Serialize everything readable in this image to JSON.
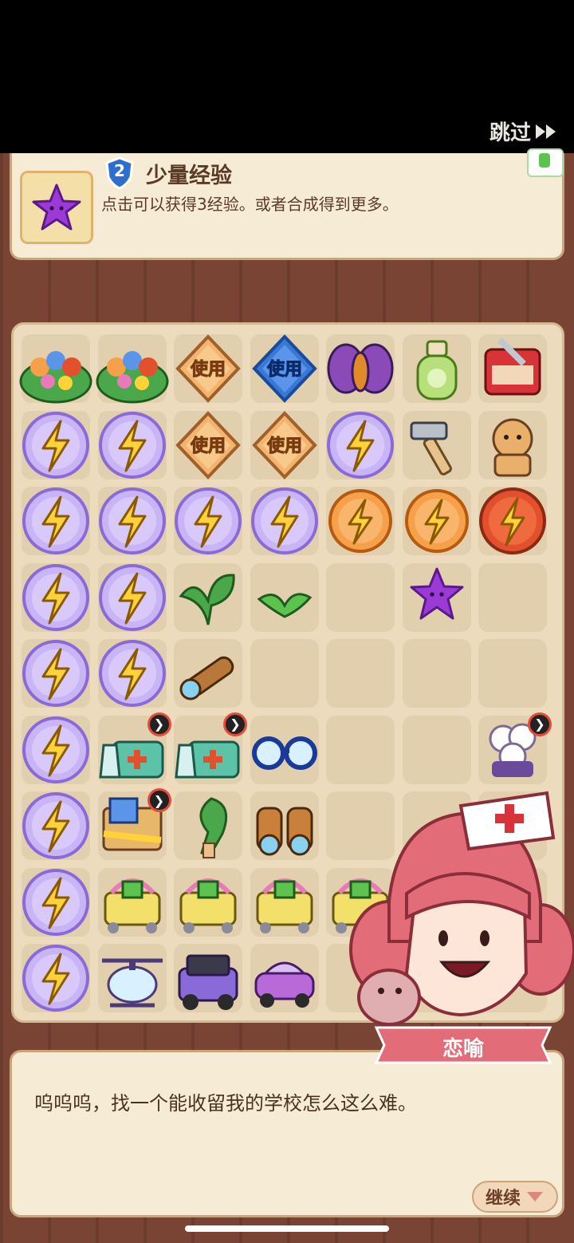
{
  "top_bar": {
    "skip_label": "跳过"
  },
  "info_card": {
    "level": "2",
    "title": "少量经验",
    "description": "点击可以获得3经验。或者合成得到更多。",
    "icon": "purple-star-icon"
  },
  "board": {
    "use_label": "使用",
    "badge_symbol": "❯"
  },
  "dialog": {
    "speaker": "恋喻",
    "text": "呜呜呜，找一个能收留我的学校怎么这么难。",
    "continue_label": "继续"
  },
  "colors": {
    "accent_pink": "#e26d78",
    "panel_bg": "#f6ecd6",
    "board_bg": "#ecdbbd",
    "energy_purple": "#b9a2f0",
    "energy_orange": "#f08a3a"
  }
}
